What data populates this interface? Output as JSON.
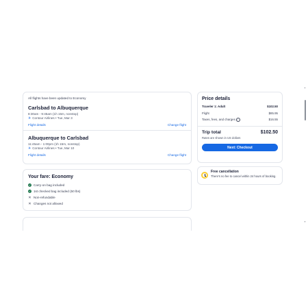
{
  "trip": {
    "notice": "All flights have been updated to Economy",
    "flights": [
      {
        "route": "Carlsbad to Albuquerque",
        "time": "8:30am - 9:45am (1h 15m, nonstop)",
        "airline": "Contour Airlines • Tue, Mar 3",
        "details_link": "Flight details",
        "change_link": "Change flight"
      },
      {
        "route": "Albuquerque to Carlsbad",
        "time": "11:45am - 1:00pm (1h 15m, nonstop)",
        "airline": "Contour Airlines • Tue, Mar 10",
        "details_link": "Flight details",
        "change_link": "Change flight"
      }
    ]
  },
  "fare": {
    "title": "Your fare: Economy",
    "items": [
      {
        "text": "Carry-on bag included",
        "icon": "check-circle-icon"
      },
      {
        "text": "1st checked bag included (50 lbs)",
        "icon": "check-circle-icon"
      },
      {
        "text": "Non-refundable",
        "icon": "x-icon"
      },
      {
        "text": "Changes not allowed",
        "icon": "x-icon"
      }
    ]
  },
  "price": {
    "title": "Price details",
    "traveler_label": "Traveler 1: Adult",
    "traveler_value": "$102.50",
    "flight_label": "Flight",
    "flight_value": "$85.95",
    "taxes_label": "Taxes, fees, and charges",
    "taxes_value": "$16.55",
    "total_label": "Trip total",
    "total_value": "$102.50",
    "rates_note": "Rates are shown in US dollars",
    "checkout_label": "Next: Checkout"
  },
  "cancellation": {
    "title": "Free cancellation",
    "description": "There's no fee to cancel within 24 hours of booking."
  },
  "colors": {
    "accent": "#1668e3",
    "success": "#227950",
    "warning": "#fbcc33"
  }
}
